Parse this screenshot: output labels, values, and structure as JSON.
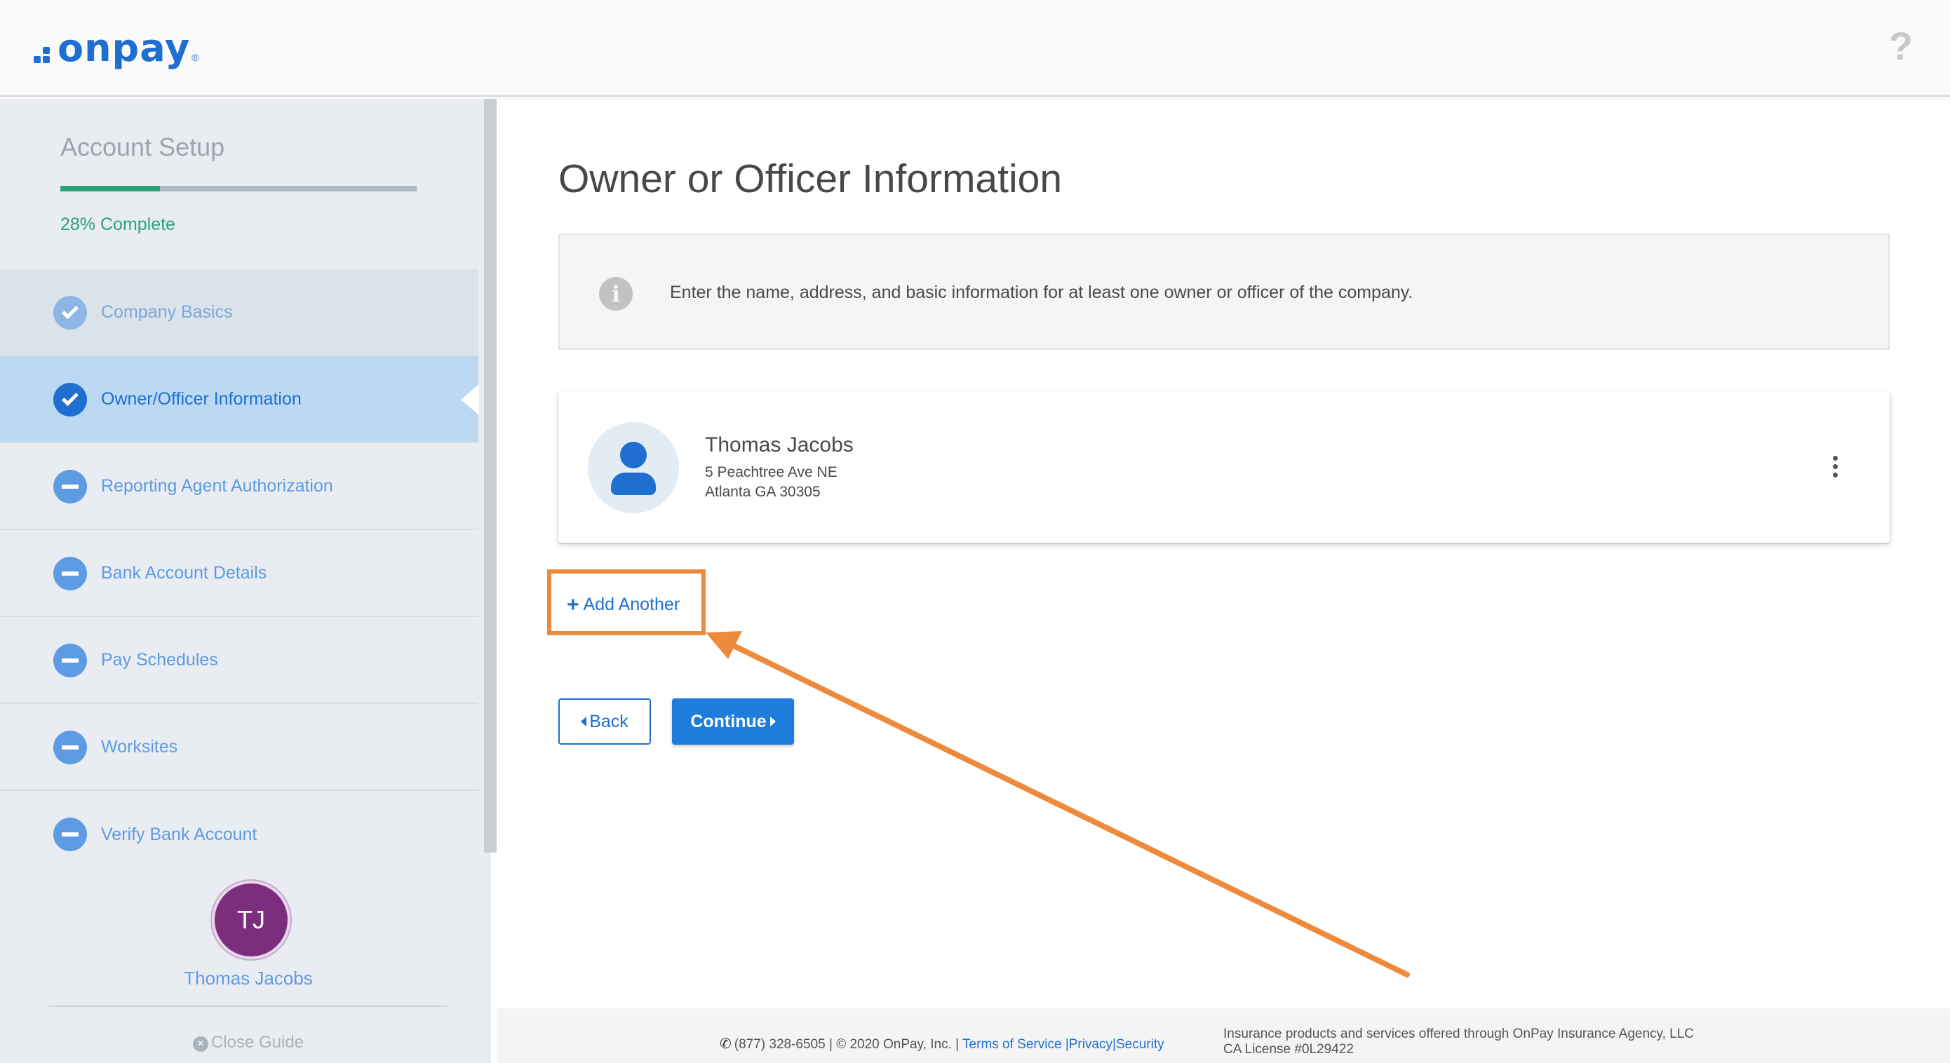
{
  "header": {
    "logo_text": "onpay",
    "logo_reg": "®",
    "help_symbol": "?"
  },
  "sidebar": {
    "title": "Account Setup",
    "progress_percent": 28,
    "progress_text": "28% Complete",
    "steps": [
      {
        "label": "Company Basics",
        "status": "done"
      },
      {
        "label": "Owner/Officer Information",
        "status": "active"
      },
      {
        "label": "Reporting Agent Authorization",
        "status": "pending"
      },
      {
        "label": "Bank Account Details",
        "status": "pending"
      },
      {
        "label": "Pay Schedules",
        "status": "pending"
      },
      {
        "label": "Worksites",
        "status": "pending"
      },
      {
        "label": "Verify Bank Account",
        "status": "pending"
      }
    ],
    "user": {
      "initials": "TJ",
      "name": "Thomas Jacobs"
    },
    "close_guide": "Close Guide"
  },
  "main": {
    "title": "Owner or Officer Information",
    "info_text": "Enter the name, address, and basic information for at least one owner or officer of the company.",
    "owner": {
      "name": "Thomas Jacobs",
      "address_line1": "5 Peachtree Ave NE",
      "address_line2": "Atlanta GA 30305"
    },
    "add_another": "Add Another",
    "back_label": "Back",
    "continue_label": "Continue"
  },
  "footer": {
    "phone": "(877) 328-6505",
    "copyright": "| © 2020 OnPay, Inc. |",
    "terms": "Terms of Service",
    "privacy": "|Privacy",
    "security": "|Security",
    "insurance_line1": "Insurance products and services offered through OnPay Insurance Agency, LLC",
    "insurance_line2": "CA License #0L29422"
  },
  "colors": {
    "brand_blue": "#1e6fd0",
    "progress_green": "#29a37a",
    "highlight_orange": "#ee8a3c",
    "avatar_purple": "#7b2d7e"
  },
  "icons": {
    "help": "question-mark-icon",
    "info": "info-circle-icon",
    "step_done": "check-circle-icon",
    "step_pending": "minus-circle-icon",
    "person": "person-icon",
    "menu": "kebab-menu-icon",
    "phone": "phone-icon",
    "close": "close-circle-icon"
  }
}
